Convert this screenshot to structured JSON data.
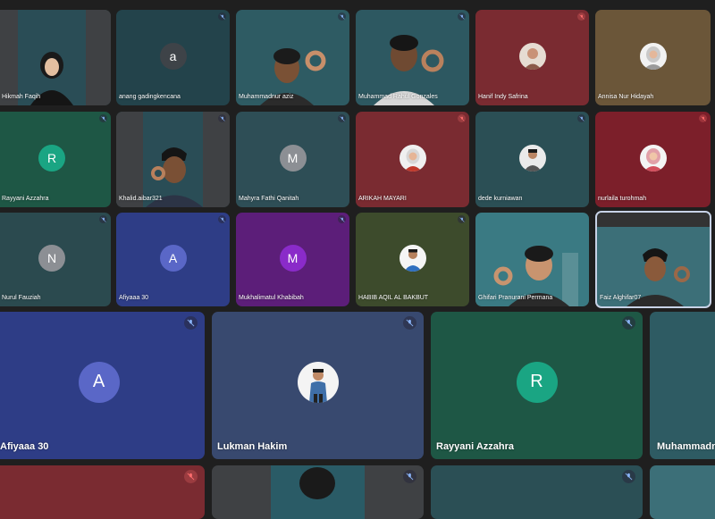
{
  "participants": {
    "row1": [
      {
        "name": "Hikmah Faqih",
        "initial": "",
        "bg": "#2a4d56"
      },
      {
        "name": "anang gadingkencana",
        "initial": "a",
        "bg": "#23434b"
      },
      {
        "name": "Muhammadnur aziz",
        "initial": "",
        "bg": "#2e5b63"
      },
      {
        "name": "Muhammad Rahul Gonzales",
        "initial": "",
        "bg": "#2d5861"
      },
      {
        "name": "Hanif Indy Safrina",
        "initial": "",
        "bg": "#7a2b31"
      },
      {
        "name": "Annisa Nur Hidayah",
        "initial": "",
        "bg": "#6b5639"
      }
    ],
    "row2": [
      {
        "name": "Rayyani Azzahra",
        "initial": "R",
        "bg": "#1e5745"
      },
      {
        "name": "Khalid.aibar321",
        "initial": "",
        "bg": "#2a4d56"
      },
      {
        "name": "Mahyra Fathi Qanitah",
        "initial": "M",
        "bg": "#2e4e56"
      },
      {
        "name": "ARIKAH MAYARI",
        "initial": "",
        "bg": "#7a2b31"
      },
      {
        "name": "dede kurniawan",
        "initial": "",
        "bg": "#2b4f55"
      },
      {
        "name": "nurlaila turohmah",
        "initial": "",
        "bg": "#7c1f2a"
      }
    ],
    "row3": [
      {
        "name": "Nurul Fauziah",
        "initial": "N",
        "bg": "#2b4a4f"
      },
      {
        "name": "Afiyaaa 30",
        "initial": "A",
        "bg": "#2e3d86"
      },
      {
        "name": "Mukhalimatul Khabibah",
        "initial": "M",
        "bg": "#5c1e79"
      },
      {
        "name": "HABIB AQIL AL BAKBUT",
        "initial": "",
        "bg": "#3d4b2c"
      },
      {
        "name": "Ghifari Pranurani Permana",
        "initial": "",
        "bg": "#3a7a83"
      },
      {
        "name": "Faiz Alghifar07",
        "initial": "",
        "bg": "#3c6f78"
      }
    ],
    "row4": [
      {
        "name": "Afiyaaa 30",
        "initial": "A",
        "bg": "#2e3d86"
      },
      {
        "name": "Lukman Hakim",
        "initial": "",
        "bg": "#38496f"
      },
      {
        "name": "Rayyani Azzahra",
        "initial": "R",
        "bg": "#1e5745"
      },
      {
        "name": "Muhammadnu",
        "initial": "",
        "bg": "#2e5b63"
      }
    ]
  },
  "colors": {
    "avatar_initial_bg_R": "#1aa583",
    "avatar_initial_bg_default": "#8c8f94",
    "avatar_A": "#5a67c7",
    "avatar_M_purple": "#8a2bc9",
    "muted_red": "#ff6e6e",
    "muted_blue": "#8ab4f8"
  }
}
